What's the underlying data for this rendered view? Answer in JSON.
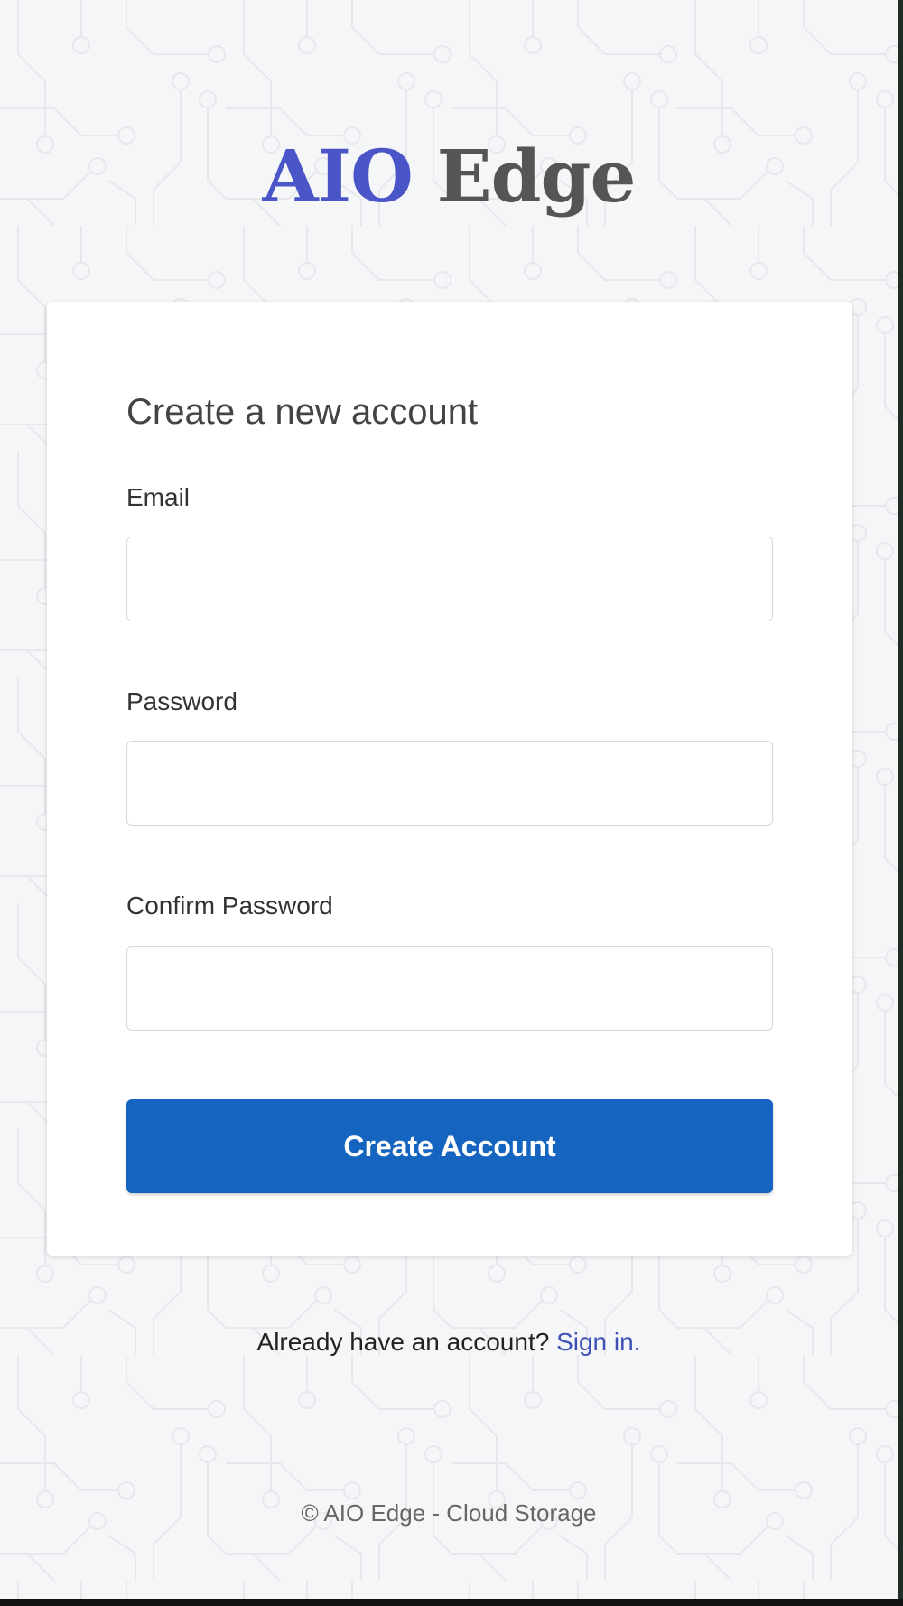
{
  "logo": {
    "part1": "AIO",
    "part2": "Edge"
  },
  "form": {
    "title": "Create a new account",
    "email_label": "Email",
    "email_value": "",
    "password_label": "Password",
    "password_value": "",
    "confirm_label": "Confirm Password",
    "confirm_value": "",
    "submit_label": "Create Account"
  },
  "signin": {
    "prompt": "Already have an account?",
    "link_label": "Sign in."
  },
  "footer": {
    "text": "© AIO Edge - Cloud Storage"
  },
  "colors": {
    "brand": "#4a55c7",
    "button": "#1565c0",
    "link": "#3f51b5",
    "background": "#f5f6f8"
  }
}
